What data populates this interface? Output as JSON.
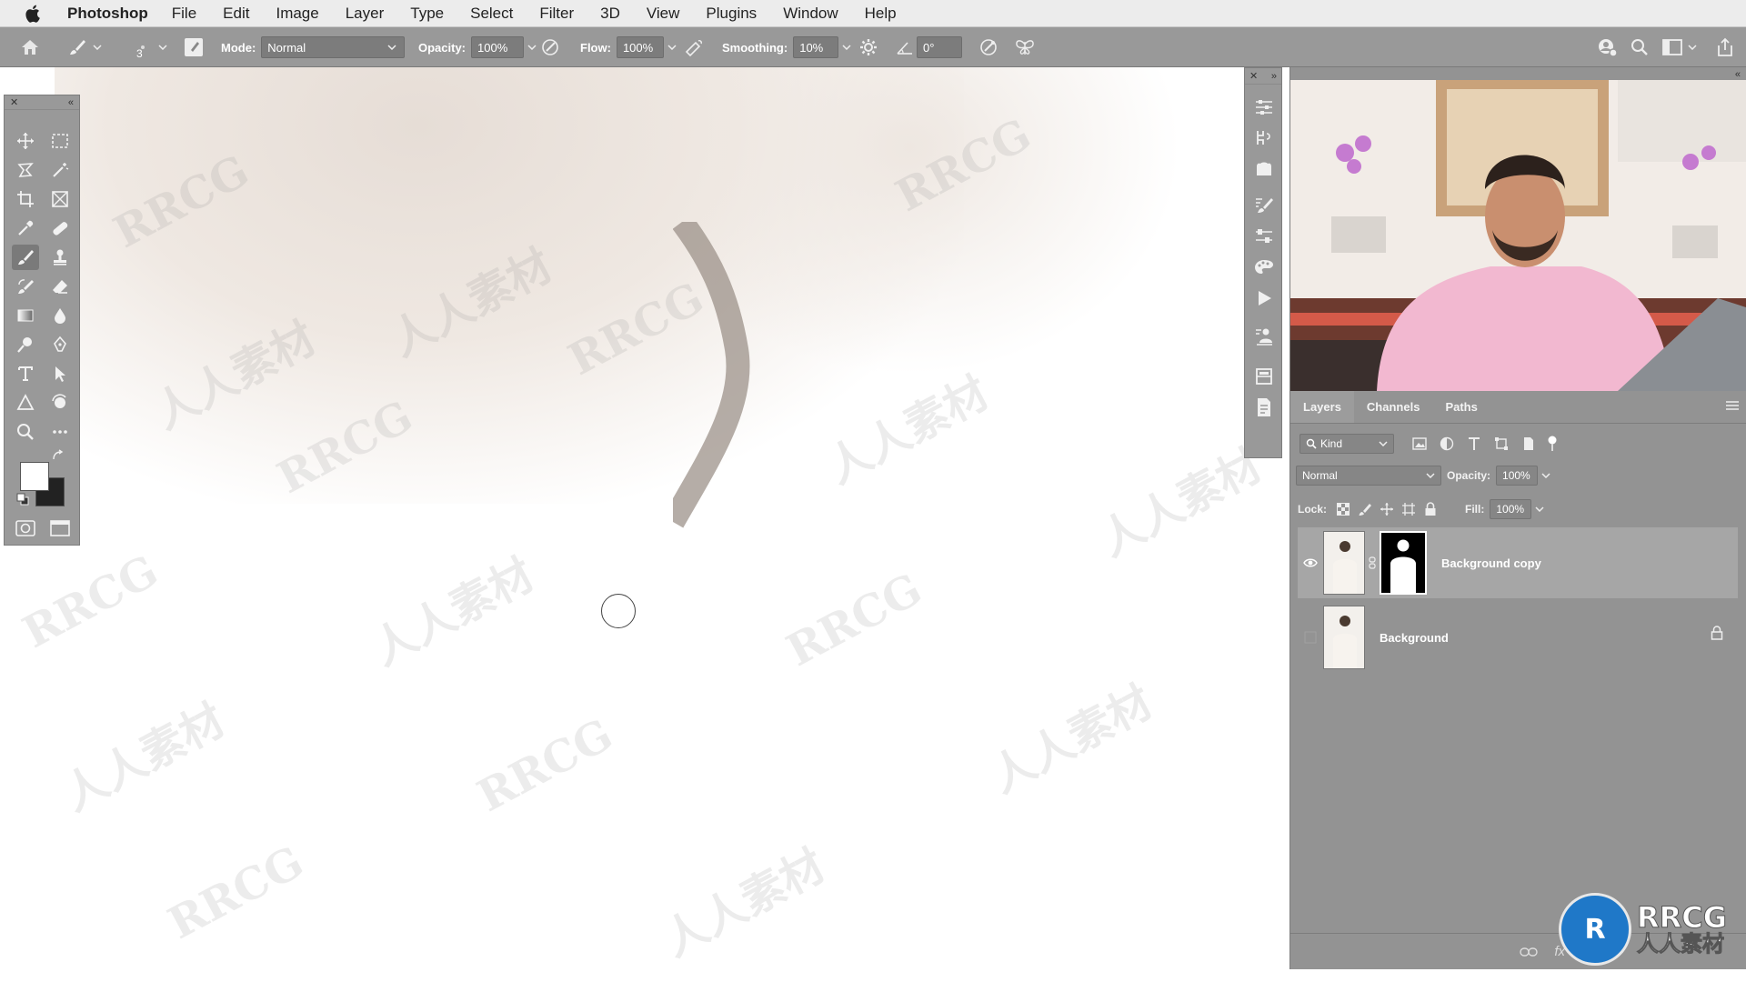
{
  "menubar": {
    "app_name": "Photoshop",
    "items": [
      "File",
      "Edit",
      "Image",
      "Layer",
      "Type",
      "Select",
      "Filter",
      "3D",
      "View",
      "Plugins",
      "Window",
      "Help"
    ]
  },
  "options": {
    "brush_size": "3",
    "mode_label": "Mode:",
    "mode_value": "Normal",
    "opacity_label": "Opacity:",
    "opacity_value": "100%",
    "flow_label": "Flow:",
    "flow_value": "100%",
    "smoothing_label": "Smoothing:",
    "smoothing_value": "10%",
    "angle_value": "0°"
  },
  "watermarks": [
    "RRCG",
    "人人素材",
    "RRCG",
    "人人素材",
    "RRCG",
    "人人素材",
    "RRCG",
    "人人素材",
    "RRCG",
    "人人素材",
    "RRCG",
    "人人素材",
    "RRCG",
    "人人素材",
    "RRCG",
    "人人素材"
  ],
  "layers_panel": {
    "tabs": [
      "Layers",
      "Channels",
      "Paths"
    ],
    "active_tab": "Layers",
    "filter_kind": "Kind",
    "blend_mode": "Normal",
    "opacity_label": "Opacity:",
    "opacity_value": "100%",
    "lock_label": "Lock:",
    "fill_label": "Fill:",
    "fill_value": "100%",
    "layers": [
      {
        "name": "Background copy",
        "visible": true,
        "selected": true,
        "has_mask": true
      },
      {
        "name": "Background",
        "visible": false,
        "selected": false,
        "locked": true
      }
    ],
    "footer_fx": "fx"
  },
  "logo": {
    "badge": "R",
    "line1": "RRCG",
    "line2": "人人素材"
  },
  "colors": {
    "panel_gray": "#939393",
    "toolbar_gray": "#999999",
    "menubar": "#ececec",
    "logo_blue": "#1f78c8"
  }
}
